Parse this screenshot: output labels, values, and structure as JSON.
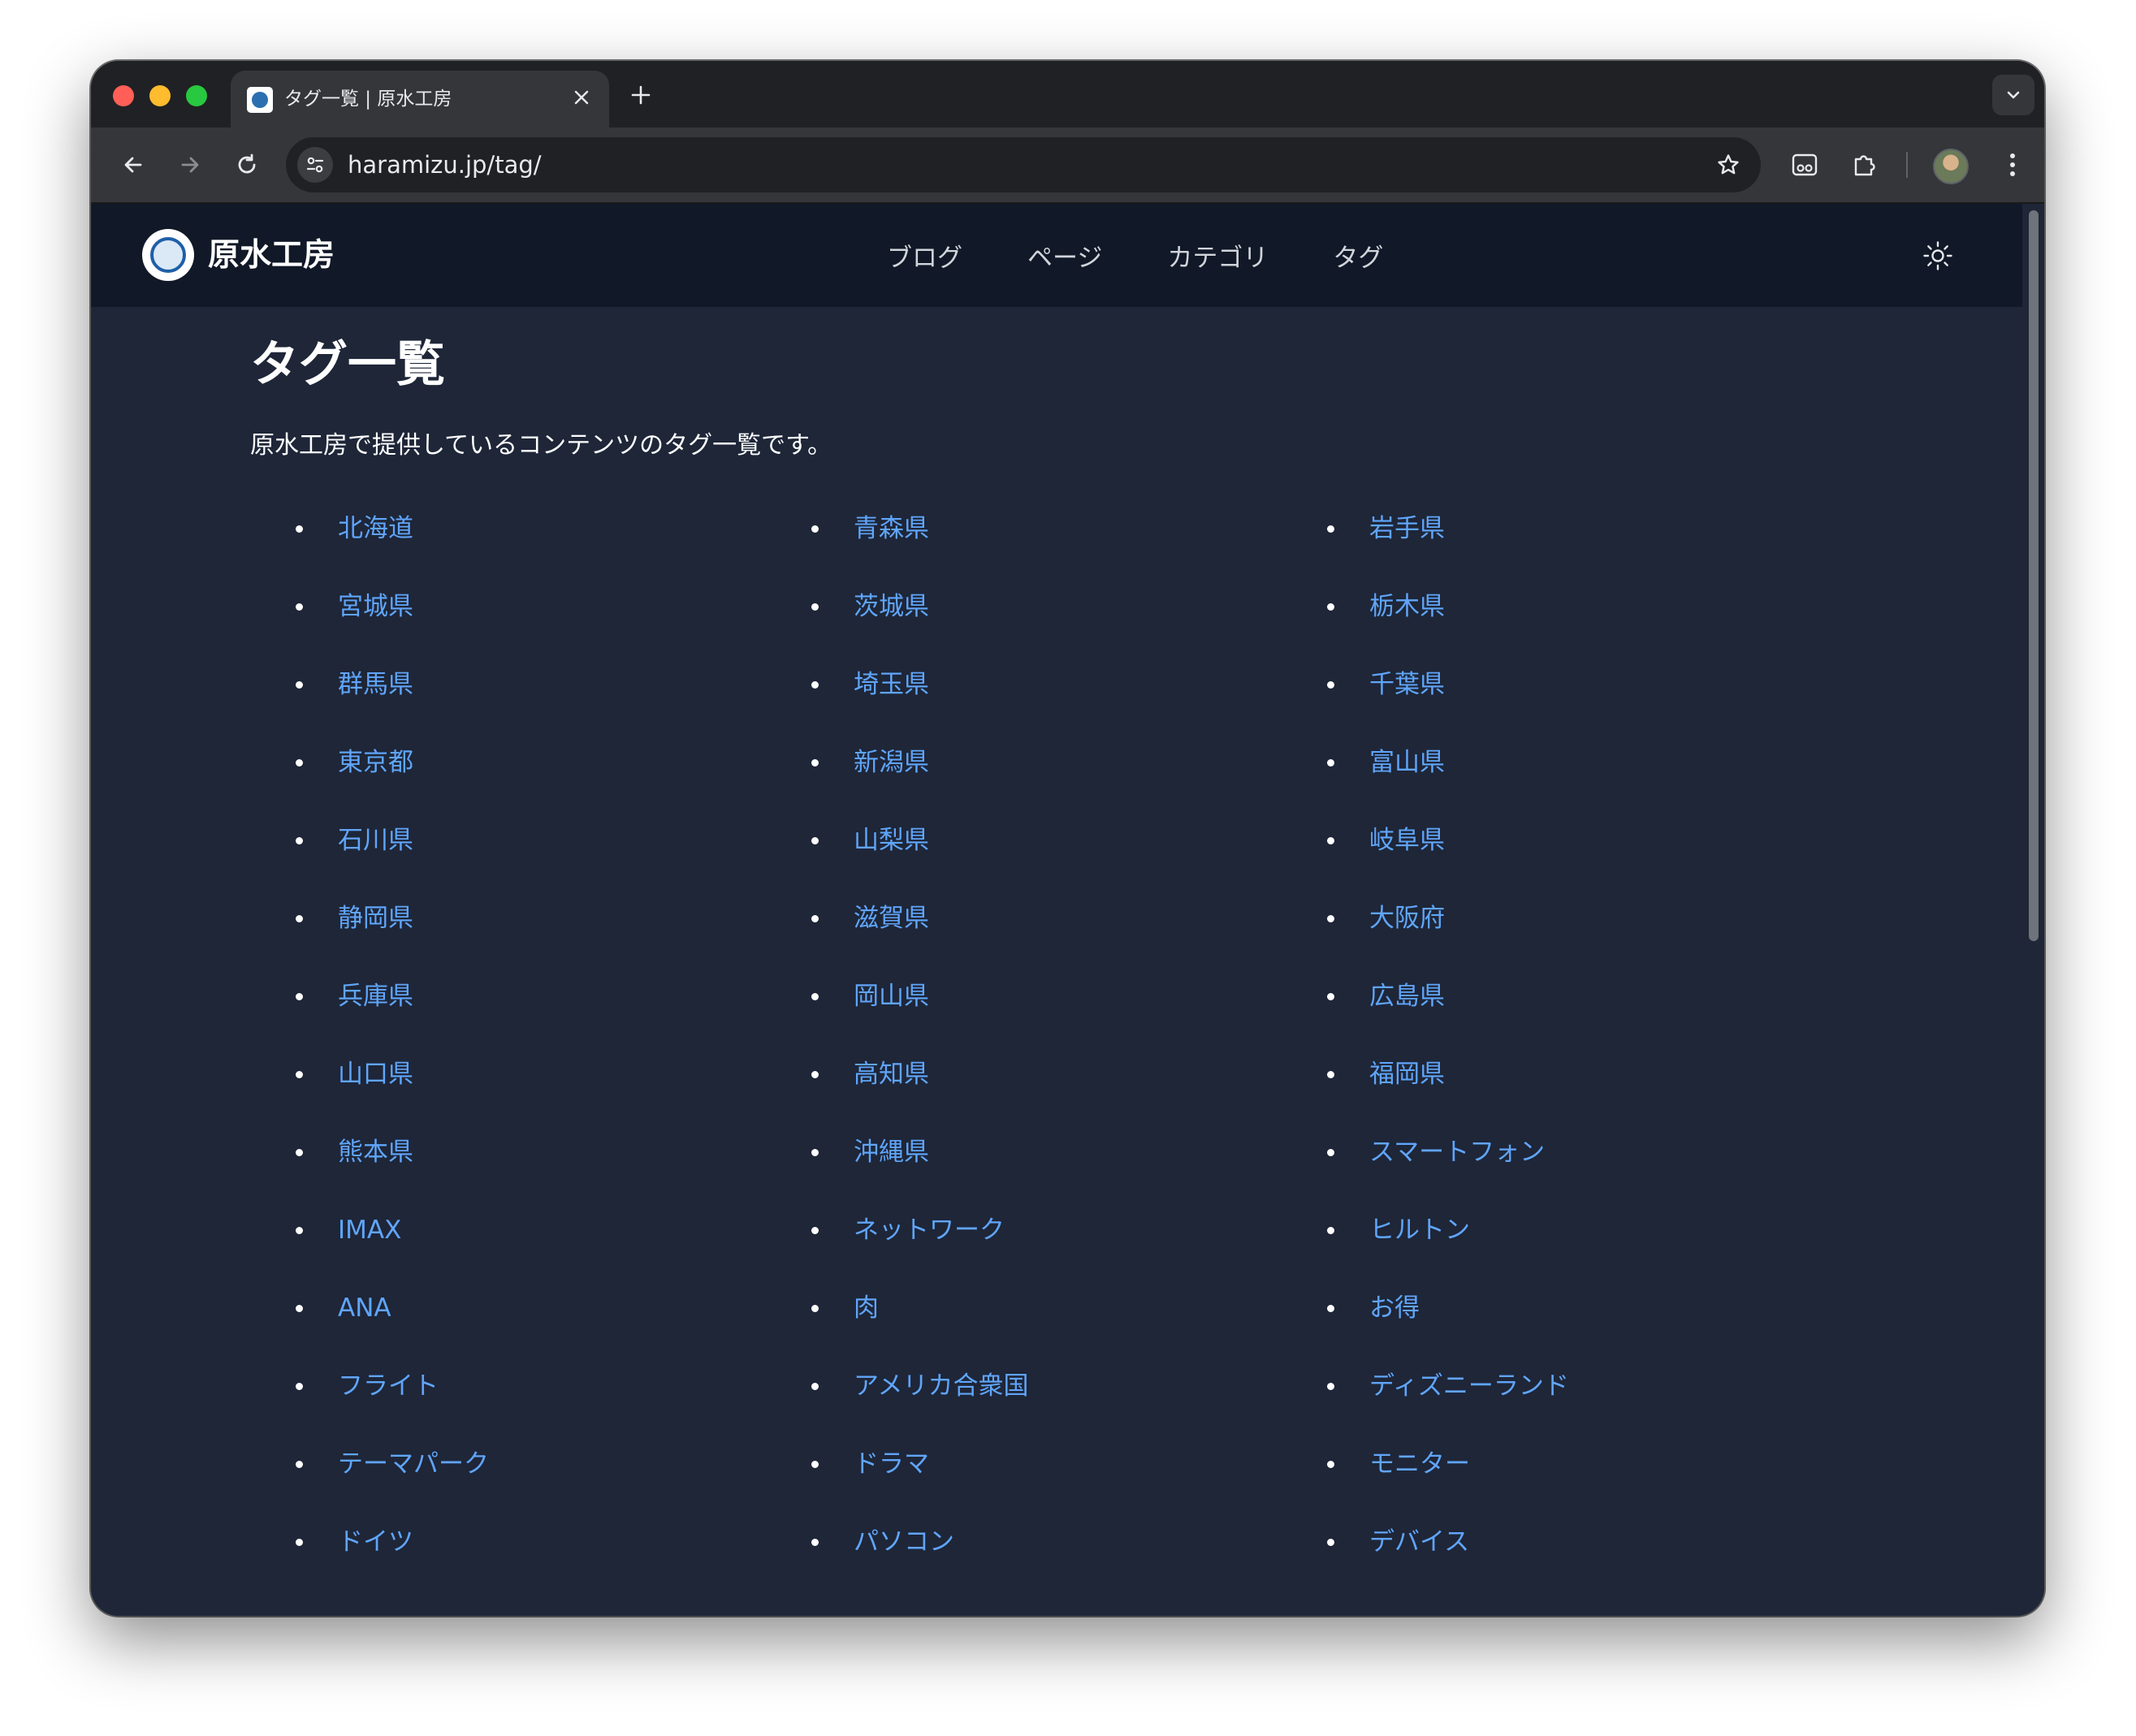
{
  "browser": {
    "tab_title": "タグ一覧 | 原水工房",
    "tab_close_icon": "close-icon",
    "new_tab_label": "+",
    "url": "haramizu.jp/tag/"
  },
  "site": {
    "brand": "原水工房",
    "nav": [
      {
        "label": "ブログ"
      },
      {
        "label": "ページ"
      },
      {
        "label": "カテゴリ"
      },
      {
        "label": "タグ"
      }
    ],
    "theme_toggle_icon": "sun-icon"
  },
  "page": {
    "title": "タグ一覧",
    "description": "原水工房で提供しているコンテンツのタグ一覧です。"
  },
  "tags": [
    "北海道",
    "青森県",
    "岩手県",
    "宮城県",
    "茨城県",
    "栃木県",
    "群馬県",
    "埼玉県",
    "千葉県",
    "東京都",
    "新潟県",
    "富山県",
    "石川県",
    "山梨県",
    "岐阜県",
    "静岡県",
    "滋賀県",
    "大阪府",
    "兵庫県",
    "岡山県",
    "広島県",
    "山口県",
    "高知県",
    "福岡県",
    "熊本県",
    "沖縄県",
    "スマートフォン",
    "IMAX",
    "ネットワーク",
    "ヒルトン",
    "ANA",
    "肉",
    "お得",
    "フライト",
    "アメリカ合衆国",
    "ディズニーランド",
    "テーマパーク",
    "ドラマ",
    "モニター",
    "ドイツ",
    "パソコン",
    "デバイス"
  ],
  "colors": {
    "header_bg": "#111827",
    "page_bg": "#1e2638",
    "link": "#60a5fa"
  }
}
